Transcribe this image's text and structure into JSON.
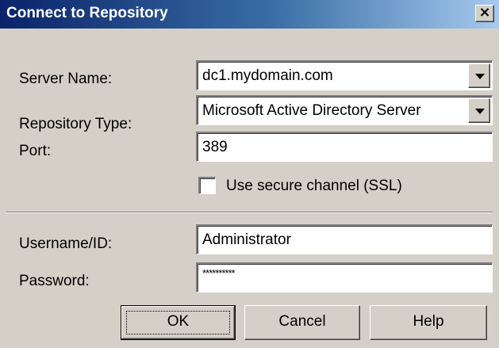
{
  "window": {
    "title": "Connect to Repository",
    "close_glyph": "×"
  },
  "form": {
    "server_name": {
      "label": "Server Name:",
      "value": "dc1.mydomain.com"
    },
    "repository_type": {
      "label": "Repository Type:",
      "value": "Microsoft Active Directory Server"
    },
    "port": {
      "label": "Port:",
      "value": "389"
    },
    "ssl": {
      "label": "Use secure channel (SSL)",
      "checked": false
    },
    "username": {
      "label": "Username/ID:",
      "value": "Administrator"
    },
    "password": {
      "label": "Password:",
      "value": "**********"
    }
  },
  "buttons": {
    "ok": "OK",
    "cancel": "Cancel",
    "help": "Help"
  },
  "icons": {
    "close": "close-icon",
    "dropdown": "chevron-down-icon"
  },
  "colors": {
    "title_gradient_start": "#0a246a",
    "title_gradient_end": "#a6caf0",
    "dialog_face": "#d4d0c8"
  }
}
